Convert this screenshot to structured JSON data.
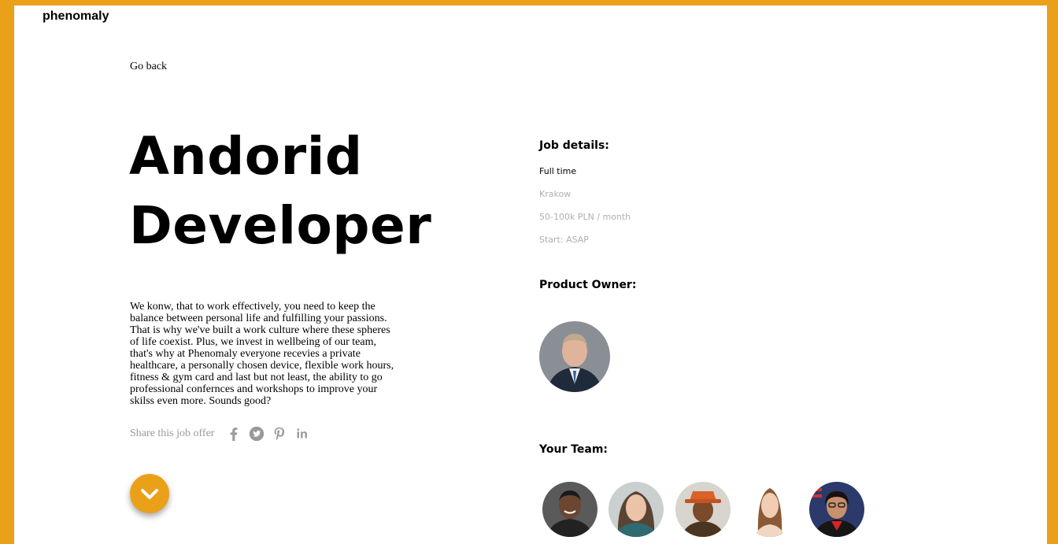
{
  "header": {
    "logo": "phenomaly"
  },
  "nav": {
    "go_back": "Go back"
  },
  "job": {
    "title_line1": "Andorid",
    "title_line2": "Developer",
    "description": "We konw, that to work effectively, you need to keep the balance between personal life and fulfilling your passions. That is why we've built a work culture where these spheres of life coexist. Plus, we invest in wellbeing of our team, that's why at Phenomaly everyone recevies a private healthcare, a personally chosen device, flexible work hours, fitness & gym card and last but not least, the ability to go professional confernces and workshops to improve your skilss even more. Sounds good?"
  },
  "share": {
    "label": "Share this job offer",
    "icons": [
      "facebook-icon",
      "twitter-icon",
      "pinterest-icon",
      "linkedin-icon"
    ]
  },
  "details": {
    "heading": "Job details:",
    "type": "Full time",
    "location": "Krakow",
    "salary": "50-100k PLN / month",
    "start": "Start: ASAP"
  },
  "product_owner": {
    "heading": "Product Owner:"
  },
  "team": {
    "heading": "Your Team:",
    "member_count": 5
  },
  "colors": {
    "accent": "#eba01a",
    "muted_text": "#b0b0b0",
    "icon_gray": "#9a9a9a"
  }
}
